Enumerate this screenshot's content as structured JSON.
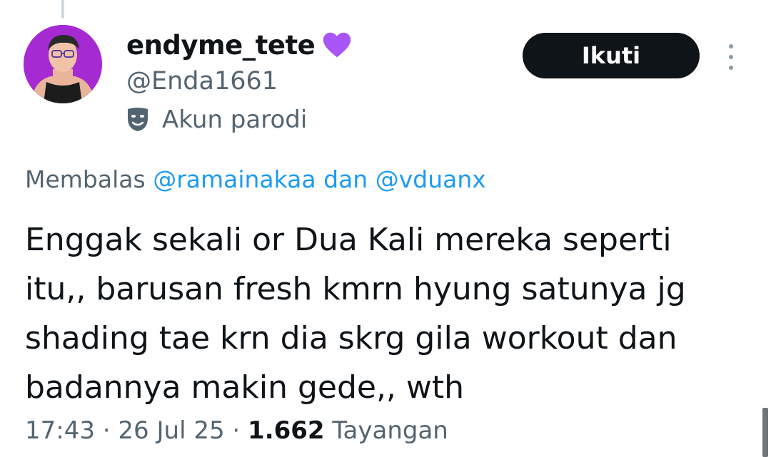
{
  "tweet": {
    "display_name": "endyme_tete",
    "handle": "@Enda1661",
    "account_label": "Akun parodi",
    "follow_label": "Ikuti",
    "reply_prefix": "Membalas",
    "reply_to_1": "@ramainakaa",
    "reply_join": "dan",
    "reply_to_2": "@vduanx",
    "text_line_1": "Enggak sekali or Dua Kali mereka seperti",
    "text_line_2": "itu,, barusan fresh kmrn hyung satunya jg",
    "text_line_3": "shading tae krn dia skrg gila workout dan",
    "text_line_4": "badannya makin gede,, wth",
    "time": "17:43",
    "separator": "·",
    "date": "26 Jul 25",
    "views_count": "1.662",
    "views_label": "Tayangan"
  },
  "icons": {
    "badge": "purple-heart-icon",
    "parody": "theater-mask-icon",
    "menu": "more-options-icon"
  },
  "colors": {
    "accent": "#1d9bf0",
    "secondary_text": "#536471",
    "primary_text": "#0f1419",
    "heart": "#a855f7",
    "avatar_bg": "#a62ad1"
  }
}
